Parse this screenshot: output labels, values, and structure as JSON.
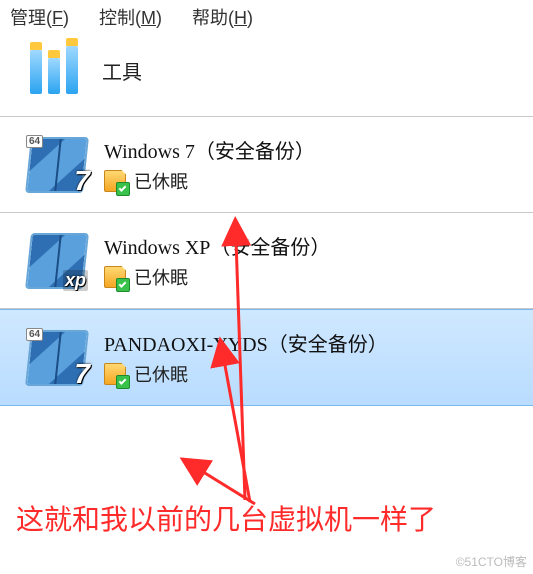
{
  "menu": {
    "manage": {
      "text": "管理(",
      "ul": "F",
      "after": ")"
    },
    "control": {
      "text": "控制(",
      "ul": "M",
      "after": ")"
    },
    "help": {
      "text": "帮助(",
      "ul": "H",
      "after": ")"
    }
  },
  "tools": {
    "label": "工具"
  },
  "vms": [
    {
      "name": "Windows 7（安全备份）",
      "status": "已休眠",
      "badge": "64",
      "os": "7",
      "selected": false
    },
    {
      "name": "Windows XP（安全备份）",
      "status": "已休眠",
      "badge": "",
      "os": "xp",
      "selected": false
    },
    {
      "name": "PANDAOXI-YYDS（安全备份）",
      "status": "已休眠",
      "badge": "64",
      "os": "7",
      "selected": true
    }
  ],
  "caption": "这就和我以前的几台虚拟机一样了",
  "watermark": "©51CTO博客"
}
